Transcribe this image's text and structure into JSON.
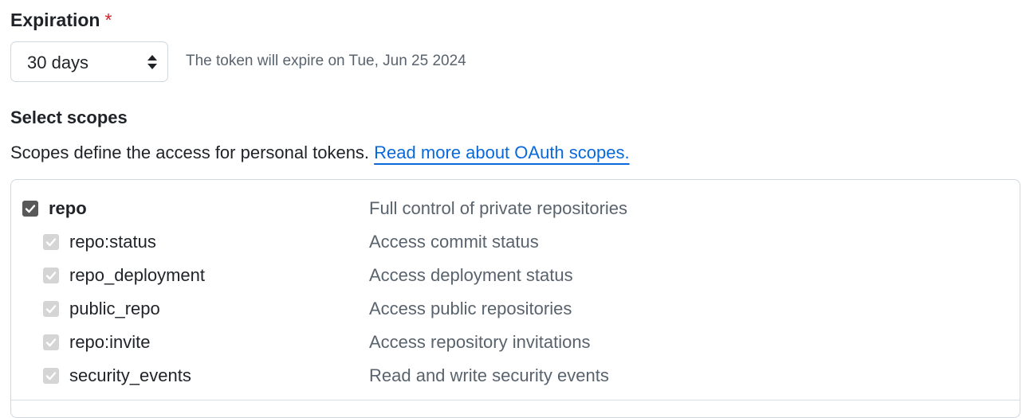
{
  "expiration": {
    "label": "Expiration",
    "required_mark": "*",
    "selected_value": "30 days",
    "note": "The token will expire on Tue, Jun 25 2024"
  },
  "scopes": {
    "title": "Select scopes",
    "description": "Scopes define the access for personal tokens.",
    "link_text": "Read more about OAuth scopes.",
    "link_color": "#0969da",
    "items": [
      {
        "name": "repo",
        "desc": "Full control of private repositories",
        "checked": true,
        "level": "parent"
      },
      {
        "name": "repo:status",
        "desc": "Access commit status",
        "checked": true,
        "level": "child"
      },
      {
        "name": "repo_deployment",
        "desc": "Access deployment status",
        "checked": true,
        "level": "child"
      },
      {
        "name": "public_repo",
        "desc": "Access public repositories",
        "checked": true,
        "level": "child"
      },
      {
        "name": "repo:invite",
        "desc": "Access repository invitations",
        "checked": true,
        "level": "child"
      },
      {
        "name": "security_events",
        "desc": "Read and write security events",
        "checked": true,
        "level": "child"
      }
    ]
  }
}
